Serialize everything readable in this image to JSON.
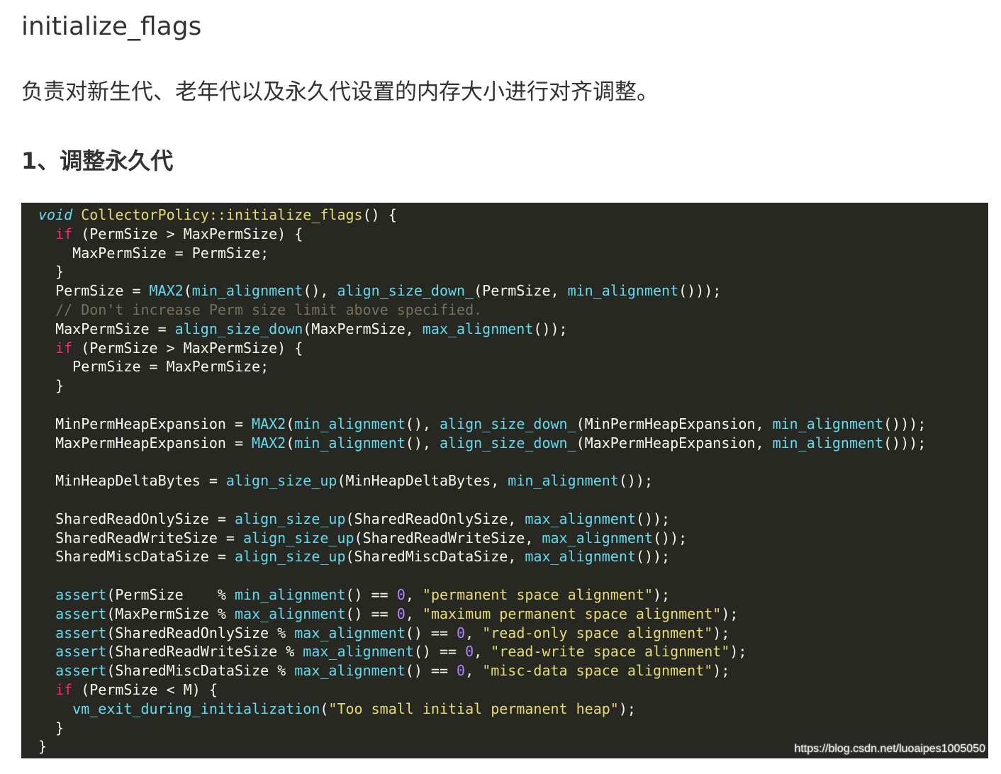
{
  "article": {
    "title": "initialize_flags",
    "description": "负责对新生代、老年代以及永久代设置的内存大小进行对齐调整。",
    "section_heading": "1、调整永久代"
  },
  "code": {
    "lines": [
      [
        {
          "t": "void",
          "c": "type"
        },
        {
          "t": " "
        },
        {
          "t": "CollectorPolicy::initialize_flags",
          "c": "func"
        },
        {
          "t": "() {"
        }
      ],
      [
        {
          "t": "  "
        },
        {
          "t": "if",
          "c": "keyword"
        },
        {
          "t": " (PermSize > MaxPermSize) {"
        }
      ],
      [
        {
          "t": "    MaxPermSize = PermSize;"
        }
      ],
      [
        {
          "t": "  }"
        }
      ],
      [
        {
          "t": "  PermSize = "
        },
        {
          "t": "MAX2",
          "c": "call"
        },
        {
          "t": "("
        },
        {
          "t": "min_alignment",
          "c": "call"
        },
        {
          "t": "(), "
        },
        {
          "t": "align_size_down_",
          "c": "call"
        },
        {
          "t": "(PermSize, "
        },
        {
          "t": "min_alignment",
          "c": "call"
        },
        {
          "t": "()));"
        }
      ],
      [
        {
          "t": "  "
        },
        {
          "t": "// Don't increase Perm size limit above specified.",
          "c": "comment"
        }
      ],
      [
        {
          "t": "  MaxPermSize = "
        },
        {
          "t": "align_size_down",
          "c": "call"
        },
        {
          "t": "(MaxPermSize, "
        },
        {
          "t": "max_alignment",
          "c": "call"
        },
        {
          "t": "());"
        }
      ],
      [
        {
          "t": "  "
        },
        {
          "t": "if",
          "c": "keyword"
        },
        {
          "t": " (PermSize > MaxPermSize) {"
        }
      ],
      [
        {
          "t": "    PermSize = MaxPermSize;"
        }
      ],
      [
        {
          "t": "  }"
        }
      ],
      [
        {
          "t": ""
        }
      ],
      [
        {
          "t": "  MinPermHeapExpansion = "
        },
        {
          "t": "MAX2",
          "c": "call"
        },
        {
          "t": "("
        },
        {
          "t": "min_alignment",
          "c": "call"
        },
        {
          "t": "(), "
        },
        {
          "t": "align_size_down_",
          "c": "call"
        },
        {
          "t": "(MinPermHeapExpansion, "
        },
        {
          "t": "min_alignment",
          "c": "call"
        },
        {
          "t": "()));"
        }
      ],
      [
        {
          "t": "  MaxPermHeapExpansion = "
        },
        {
          "t": "MAX2",
          "c": "call"
        },
        {
          "t": "("
        },
        {
          "t": "min_alignment",
          "c": "call"
        },
        {
          "t": "(), "
        },
        {
          "t": "align_size_down_",
          "c": "call"
        },
        {
          "t": "(MaxPermHeapExpansion, "
        },
        {
          "t": "min_alignment",
          "c": "call"
        },
        {
          "t": "()));"
        }
      ],
      [
        {
          "t": ""
        }
      ],
      [
        {
          "t": "  MinHeapDeltaBytes = "
        },
        {
          "t": "align_size_up",
          "c": "call"
        },
        {
          "t": "(MinHeapDeltaBytes, "
        },
        {
          "t": "min_alignment",
          "c": "call"
        },
        {
          "t": "());"
        }
      ],
      [
        {
          "t": ""
        }
      ],
      [
        {
          "t": "  SharedReadOnlySize = "
        },
        {
          "t": "align_size_up",
          "c": "call"
        },
        {
          "t": "(SharedReadOnlySize, "
        },
        {
          "t": "max_alignment",
          "c": "call"
        },
        {
          "t": "());"
        }
      ],
      [
        {
          "t": "  SharedReadWriteSize = "
        },
        {
          "t": "align_size_up",
          "c": "call"
        },
        {
          "t": "(SharedReadWriteSize, "
        },
        {
          "t": "max_alignment",
          "c": "call"
        },
        {
          "t": "());"
        }
      ],
      [
        {
          "t": "  SharedMiscDataSize = "
        },
        {
          "t": "align_size_up",
          "c": "call"
        },
        {
          "t": "(SharedMiscDataSize, "
        },
        {
          "t": "max_alignment",
          "c": "call"
        },
        {
          "t": "());"
        }
      ],
      [
        {
          "t": ""
        }
      ],
      [
        {
          "t": "  "
        },
        {
          "t": "assert",
          "c": "call"
        },
        {
          "t": "(PermSize    % "
        },
        {
          "t": "min_alignment",
          "c": "call"
        },
        {
          "t": "() == "
        },
        {
          "t": "0",
          "c": "number"
        },
        {
          "t": ", "
        },
        {
          "t": "\"permanent space alignment\"",
          "c": "string"
        },
        {
          "t": ");"
        }
      ],
      [
        {
          "t": "  "
        },
        {
          "t": "assert",
          "c": "call"
        },
        {
          "t": "(MaxPermSize % "
        },
        {
          "t": "max_alignment",
          "c": "call"
        },
        {
          "t": "() == "
        },
        {
          "t": "0",
          "c": "number"
        },
        {
          "t": ", "
        },
        {
          "t": "\"maximum permanent space alignment\"",
          "c": "string"
        },
        {
          "t": ");"
        }
      ],
      [
        {
          "t": "  "
        },
        {
          "t": "assert",
          "c": "call"
        },
        {
          "t": "(SharedReadOnlySize % "
        },
        {
          "t": "max_alignment",
          "c": "call"
        },
        {
          "t": "() == "
        },
        {
          "t": "0",
          "c": "number"
        },
        {
          "t": ", "
        },
        {
          "t": "\"read-only space alignment\"",
          "c": "string"
        },
        {
          "t": ");"
        }
      ],
      [
        {
          "t": "  "
        },
        {
          "t": "assert",
          "c": "call"
        },
        {
          "t": "(SharedReadWriteSize % "
        },
        {
          "t": "max_alignment",
          "c": "call"
        },
        {
          "t": "() == "
        },
        {
          "t": "0",
          "c": "number"
        },
        {
          "t": ", "
        },
        {
          "t": "\"read-write space alignment\"",
          "c": "string"
        },
        {
          "t": ");"
        }
      ],
      [
        {
          "t": "  "
        },
        {
          "t": "assert",
          "c": "call"
        },
        {
          "t": "(SharedMiscDataSize % "
        },
        {
          "t": "max_alignment",
          "c": "call"
        },
        {
          "t": "() == "
        },
        {
          "t": "0",
          "c": "number"
        },
        {
          "t": ", "
        },
        {
          "t": "\"misc-data space alignment\"",
          "c": "string"
        },
        {
          "t": ");"
        }
      ],
      [
        {
          "t": "  "
        },
        {
          "t": "if",
          "c": "keyword"
        },
        {
          "t": " (PermSize < M) {"
        }
      ],
      [
        {
          "t": "    "
        },
        {
          "t": "vm_exit_during_initialization",
          "c": "call"
        },
        {
          "t": "("
        },
        {
          "t": "\"Too small initial permanent heap\"",
          "c": "string"
        },
        {
          "t": ");"
        }
      ],
      [
        {
          "t": "  }"
        }
      ],
      [
        {
          "t": "}"
        }
      ]
    ],
    "colors": {
      "background": "#272822",
      "keyword": "#f92672",
      "call": "#66d9ef",
      "string": "#e6db74",
      "number": "#ae81ff",
      "comment": "#75715e",
      "plain": "#f8f8f2"
    }
  },
  "watermark": "https://blog.csdn.net/luoaipes1005050"
}
